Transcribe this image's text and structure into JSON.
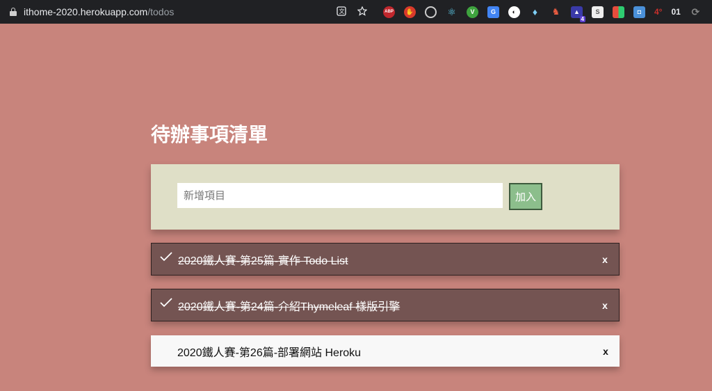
{
  "browser": {
    "url_host": "ithome-2020.herokuapp.com",
    "url_path": "/todos",
    "badge_count": "4",
    "ext_text_a": "4°",
    "ext_text_b": "01",
    "ext_abp": "ABP",
    "ext_s": "S"
  },
  "page": {
    "title": "待辦事項清單"
  },
  "add_form": {
    "placeholder": "新增項目",
    "value": "",
    "button_label": "加入"
  },
  "todos": [
    {
      "text": "2020鐵人賽-第25篇-實作 Todo List",
      "done": true,
      "delete_label": "x"
    },
    {
      "text": "2020鐵人賽-第24篇-介紹Thymeleaf 樣版引擎",
      "done": true,
      "delete_label": "x"
    },
    {
      "text": "2020鐵人賽-第26篇-部署網站 Heroku",
      "done": false,
      "delete_label": "x"
    }
  ],
  "colors": {
    "background": "#c8847c",
    "panel": "#dfdfc7",
    "done_item": "#745452",
    "pending_item": "#f8f8f8",
    "add_button": "#8cbe8c"
  }
}
